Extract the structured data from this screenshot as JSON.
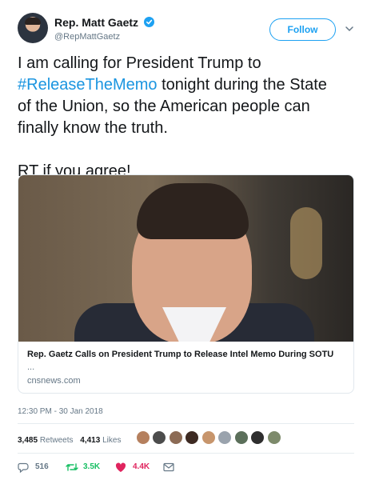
{
  "user": {
    "name": "Rep. Matt Gaetz",
    "handle": "@RepMattGaetz",
    "follow_label": "Follow"
  },
  "tweet": {
    "line1": "I am calling for President Trump to",
    "hashtag": "#ReleaseTheMemo",
    "line2_rest": " tonight during the State",
    "line3": "of the Union, so the American people can",
    "line4": "finally know the truth.",
    "line5": "RT if you agree!"
  },
  "card": {
    "title": "Rep. Gaetz Calls on President Trump to Release Intel Memo During SOTU",
    "description": "...",
    "domain": "cnsnews.com"
  },
  "timestamp": "12:30 PM - 30 Jan 2018",
  "stats": {
    "retweets_count": "3,485",
    "retweets_label": "Retweets",
    "likes_count": "4,413",
    "likes_label": "Likes"
  },
  "actions": {
    "replies": "516",
    "retweets": "3.5K",
    "likes": "4.4K"
  },
  "colors": {
    "accent": "#1da1f2",
    "retweet": "#17bf63",
    "like": "#e0245e",
    "muted": "#657786"
  }
}
